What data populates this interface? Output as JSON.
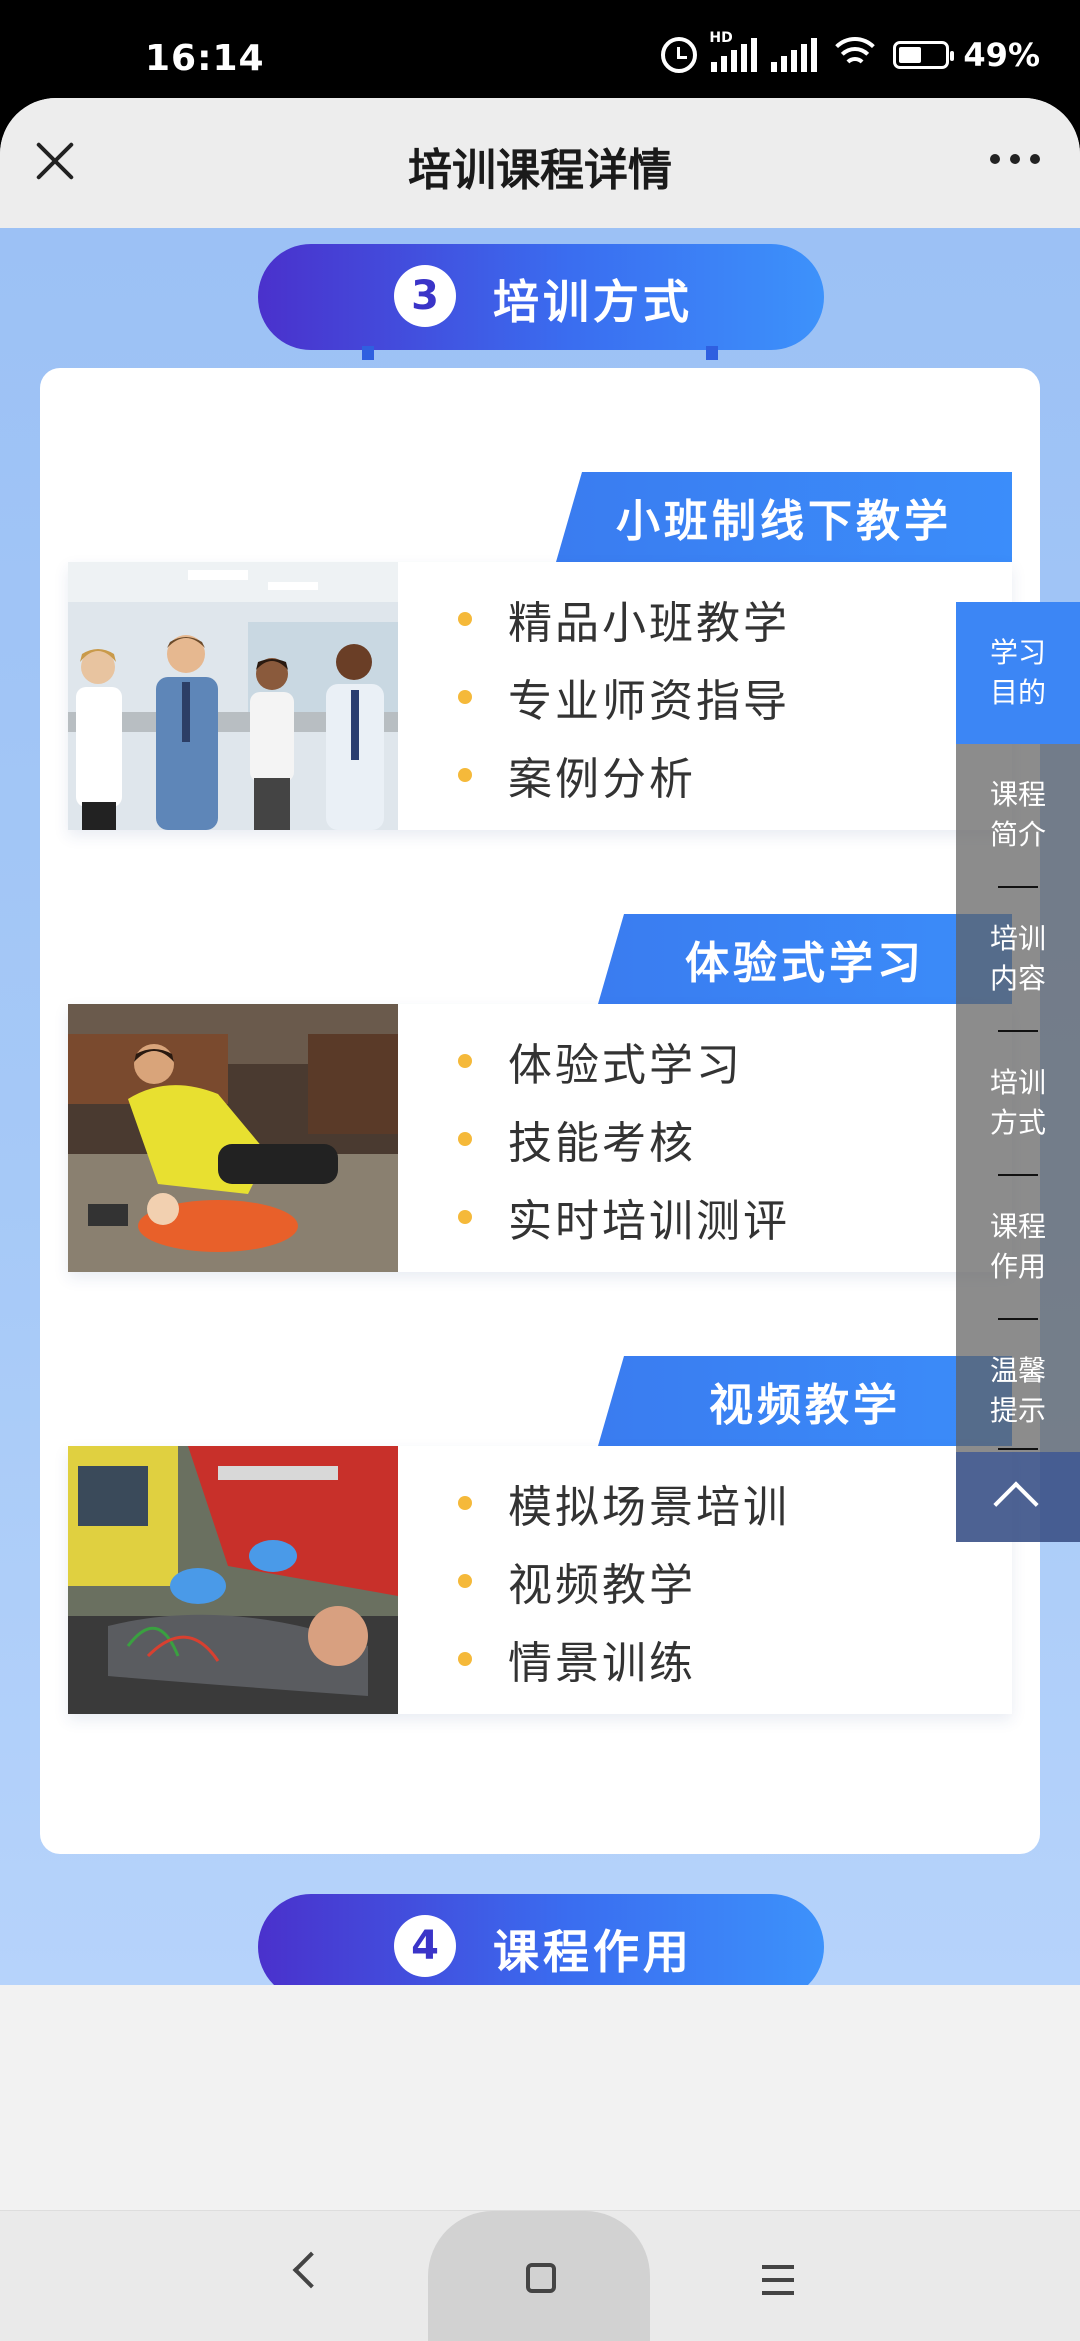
{
  "status_bar": {
    "time": "16:14",
    "hd": "HD",
    "battery": "49%",
    "battery_level": 0.49
  },
  "topbar": {
    "title": "培训课程详情"
  },
  "section3": {
    "number": "3",
    "title": "培训方式"
  },
  "section4": {
    "number": "4",
    "title": "课程作用"
  },
  "blocks": [
    {
      "tag": "小班制线下教学",
      "items": [
        "精品小班教学",
        "专业师资指导",
        "案例分析"
      ]
    },
    {
      "tag": "体验式学习",
      "items": [
        "体验式学习",
        "技能考核",
        "实时培训测评"
      ]
    },
    {
      "tag": "视频教学",
      "items": [
        "模拟场景培训",
        "视频教学",
        "情景训练"
      ]
    }
  ],
  "side_nav": {
    "items": [
      {
        "label": "学习\n目的",
        "active": true
      },
      {
        "label": "课程\n简介",
        "active": false
      },
      {
        "label": "培训\n内容",
        "active": false
      },
      {
        "label": "培训\n方式",
        "active": false
      },
      {
        "label": "课程\n作用",
        "active": false
      },
      {
        "label": "温馨\n提示",
        "active": false
      }
    ]
  },
  "colors": {
    "accent": "#3b8dfa",
    "pill_start": "#4a31cc",
    "dot": "#f5b93a",
    "background": "#a6c9f7"
  }
}
